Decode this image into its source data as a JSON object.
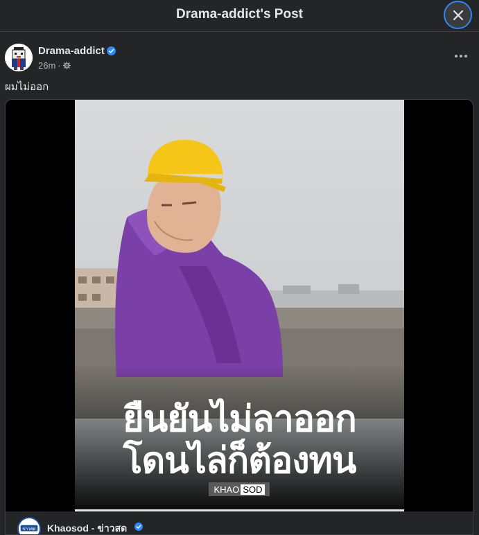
{
  "modal": {
    "title": "Drama-addict's Post",
    "close_icon": "close-icon"
  },
  "post": {
    "author": "Drama-addict",
    "verified": true,
    "time": "26m",
    "privacy_icon": "gear-icon",
    "more_icon": "more-dots-icon",
    "text": "ผมไม่ออก"
  },
  "video": {
    "caption_line1": "ยืนยันไม่ลาออก",
    "caption_line2": "โดนไล่ก็ต้องทน",
    "watermark_left": "KHAO",
    "watermark_right": "SOD"
  },
  "shared": {
    "page_name": "Khaosod - ข่าวสด",
    "avatar_text": "ข่าวสด",
    "verified": true
  },
  "colors": {
    "background": "#242526",
    "accent": "#2d88ff",
    "raincoat": "#7b3fa8",
    "helmet": "#f5c518"
  }
}
